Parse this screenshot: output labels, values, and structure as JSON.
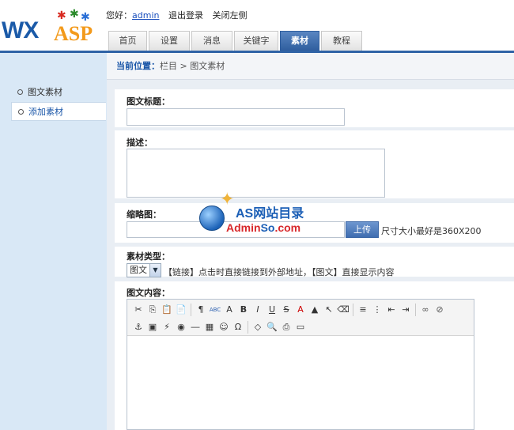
{
  "header": {
    "logo_text_1": "WX",
    "logo_text_2": "ASP",
    "greeting_prefix": "您好：",
    "username": "admin",
    "logout_label": "退出登录",
    "close_left_label": "关闭左侧"
  },
  "tabs": [
    {
      "label": "首页",
      "active": false
    },
    {
      "label": "设置",
      "active": false
    },
    {
      "label": "消息",
      "active": false
    },
    {
      "label": "关键字",
      "active": false
    },
    {
      "label": "素材",
      "active": true
    },
    {
      "label": "教程",
      "active": false
    }
  ],
  "sidebar": {
    "items": [
      {
        "label": "图文素材",
        "active": false
      },
      {
        "label": "添加素材",
        "active": true
      }
    ]
  },
  "breadcrumb": {
    "label": "当前位置：",
    "path": "栏目 > 图文素材"
  },
  "form": {
    "title_label": "图文标题：",
    "title_value": "",
    "desc_label": "描述：",
    "desc_value": "",
    "thumb_label": "缩略图：",
    "thumb_value": "",
    "upload_label": "上传",
    "size_hint": "尺寸大小最好是360X200",
    "type_label": "素材类型：",
    "type_selected": "图文",
    "type_hint": "【链接】点击时直接链接到外部地址，【图文】直接显示内容",
    "content_label": "图文内容："
  },
  "editor": {
    "row1": [
      "cut-icon",
      "copy-icon",
      "paste-icon",
      "paste-text-icon",
      "|",
      "paste-word-icon",
      "spellcheck-icon",
      "find-replace-icon",
      "bold-icon",
      "italic-icon",
      "underline-icon",
      "strikethrough-icon",
      "font-color-icon",
      "highlight-icon",
      "select-icon",
      "eraser-icon",
      "|",
      "align-left-icon",
      "ordered-list-icon",
      "outdent-icon",
      "indent-icon",
      "|",
      "link-icon",
      "unlink-icon"
    ],
    "row1_glyphs": [
      "✂",
      "⎘",
      "📋",
      "📄",
      "|",
      "¶",
      "ABC",
      "A",
      "B",
      "I",
      "U",
      "S",
      "A",
      "▲",
      "↖",
      "⌫",
      "|",
      "≡",
      "⋮",
      "⇤",
      "⇥",
      "|",
      "∞",
      "⊘"
    ],
    "row2": [
      "anchor-icon",
      "image-icon",
      "flash-icon",
      "media-icon",
      "hr-icon",
      "table-icon",
      "smiley-icon",
      "special-char-icon",
      "|",
      "source-icon",
      "preview-icon",
      "print-icon",
      "fullscreen-icon"
    ],
    "row2_glyphs": [
      "⚓",
      "▣",
      "⚡",
      "◉",
      "―",
      "▦",
      "☺",
      "Ω",
      "|",
      "◇",
      "🔍",
      "⎙",
      "▭"
    ]
  },
  "watermark": {
    "title": "AS网站目录",
    "url_part1": "Admin",
    "url_part2": "So",
    "url_part3": ".com"
  }
}
